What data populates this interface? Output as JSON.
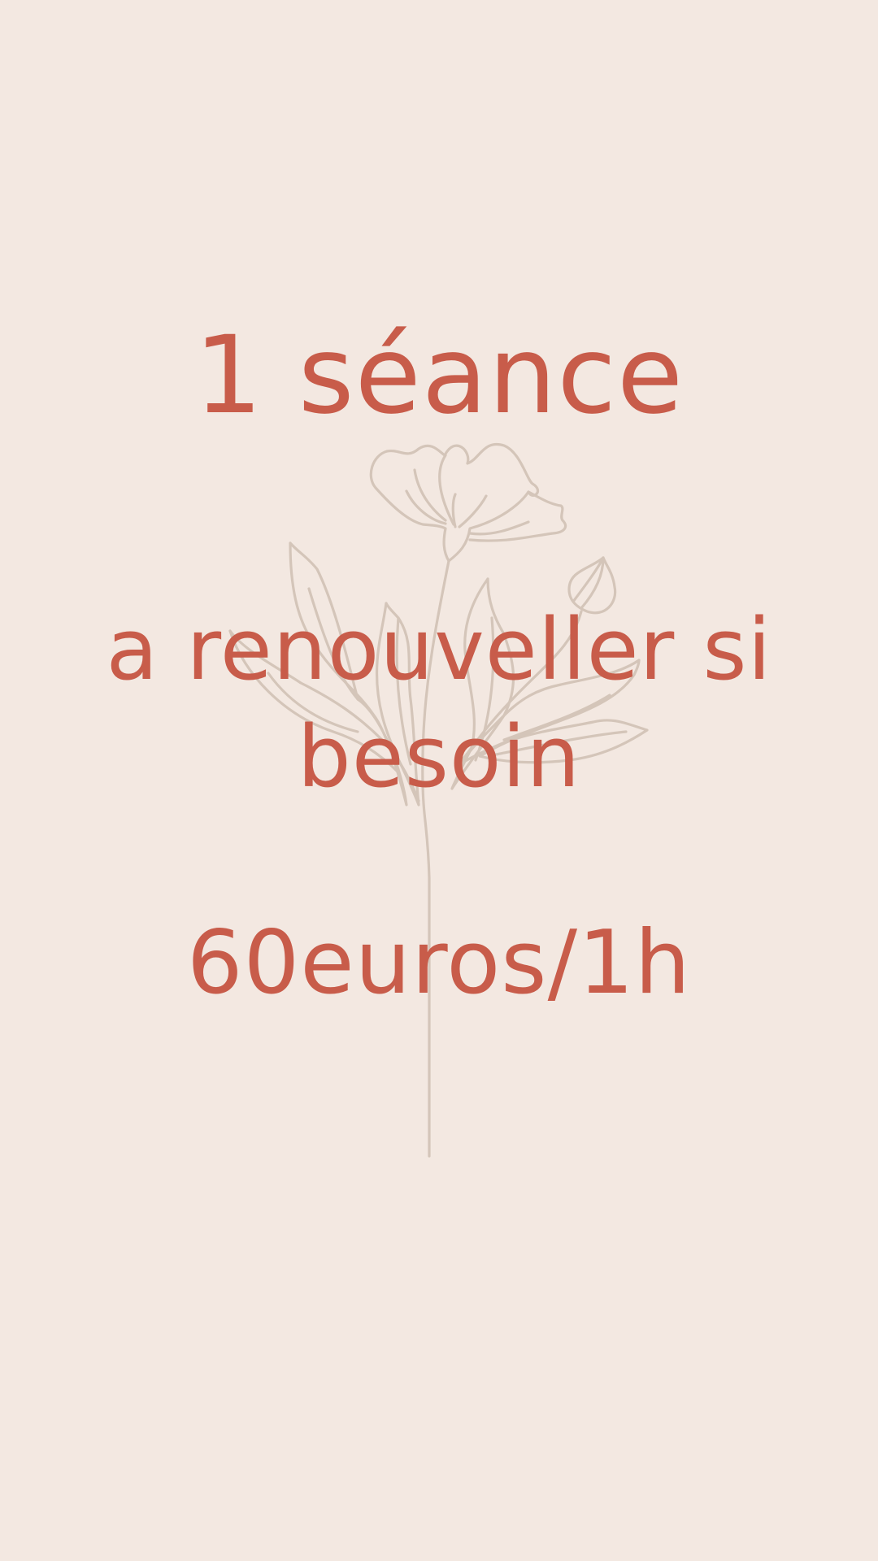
{
  "background_color": "#f3e8e1",
  "text_color": "#c85c4a",
  "illustration_color": "#d4c5b9",
  "illustration_icon": "flower-line-art-icon",
  "title": "1 séance",
  "subtitle": "a renouveller si besoin",
  "price": "60euros/1h"
}
